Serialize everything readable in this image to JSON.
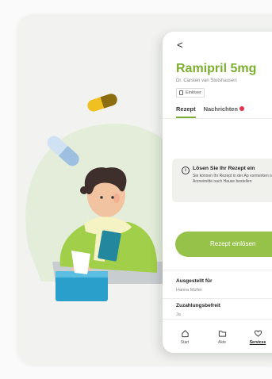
{
  "colors": {
    "accent": "#7cae2f",
    "button": "#96c24a",
    "badge": "#e0344c"
  },
  "header": {
    "back_icon": "chevron-left-icon",
    "back_glyph": "<"
  },
  "medication": {
    "name": "Ramipril 5mg",
    "doctor": "Dr. Carsten van Stotshausen",
    "tag": "Einlöser"
  },
  "tabs": [
    {
      "label": "Rezept",
      "active": true
    },
    {
      "label": "Nachrichten",
      "badge": true
    }
  ],
  "info": {
    "icon_glyph": "i",
    "title": "Lösen Sie Ihr Rezept ein",
    "text": "Sie können Ihr Rezept in der Ap vormerken oder das Arzneimitte nach Hause bestellen"
  },
  "cta": {
    "label": "Rezept einlösen"
  },
  "details": [
    {
      "label": "Ausgestellt für",
      "value": "Hanna Müller"
    },
    {
      "label": "Zuzahlungsbefreit",
      "value": "Ja"
    }
  ],
  "nav": [
    {
      "label": "Start",
      "icon": "home-icon"
    },
    {
      "label": "Akte",
      "icon": "folder-icon"
    },
    {
      "label": "Services",
      "icon": "heart-icon",
      "active": true
    }
  ]
}
